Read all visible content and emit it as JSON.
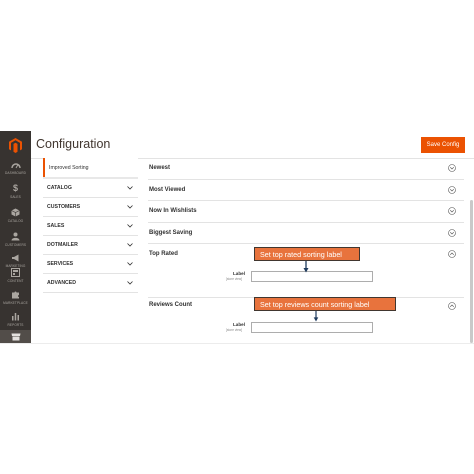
{
  "admin_nav": {
    "items": [
      {
        "label": "DASHBOARD",
        "icon": "gauge-icon"
      },
      {
        "label": "SALES",
        "icon": "dollar-icon"
      },
      {
        "label": "CATALOG",
        "icon": "box-icon"
      },
      {
        "label": "CUSTOMERS",
        "icon": "person-icon"
      },
      {
        "label": "MARKETING",
        "icon": "megaphone-icon"
      },
      {
        "label": "CONTENT",
        "icon": "layout-icon"
      },
      {
        "label": "MARKETPLACE",
        "icon": "puzzle-icon"
      },
      {
        "label": "REPORTS",
        "icon": "bar-chart-icon"
      }
    ],
    "active_icon": "store-icon",
    "brand_color": "#eb5202"
  },
  "header": {
    "title": "Configuration",
    "save_label": "Save Config"
  },
  "tabs": {
    "active": "Improved Sorting",
    "groups": [
      "CATALOG",
      "CUSTOMERS",
      "SALES",
      "DOTMAILER",
      "SERVICES",
      "ADVANCED"
    ]
  },
  "sections": [
    {
      "title": "Newest"
    },
    {
      "title": "Most Viewed"
    },
    {
      "title": "Now In Wishlists"
    },
    {
      "title": "Biggest Saving"
    },
    {
      "title": "Top Rated",
      "field_label": "Label",
      "field_scope": "[store view]",
      "field_value": ""
    },
    {
      "title": "Reviews Count",
      "field_label": "Label",
      "field_scope": "[store view]",
      "field_value": ""
    }
  ],
  "callouts": {
    "top_rated": "Set top rated sorting label",
    "reviews_count": "Set top reviews count sorting label",
    "color": "#e8733d"
  }
}
